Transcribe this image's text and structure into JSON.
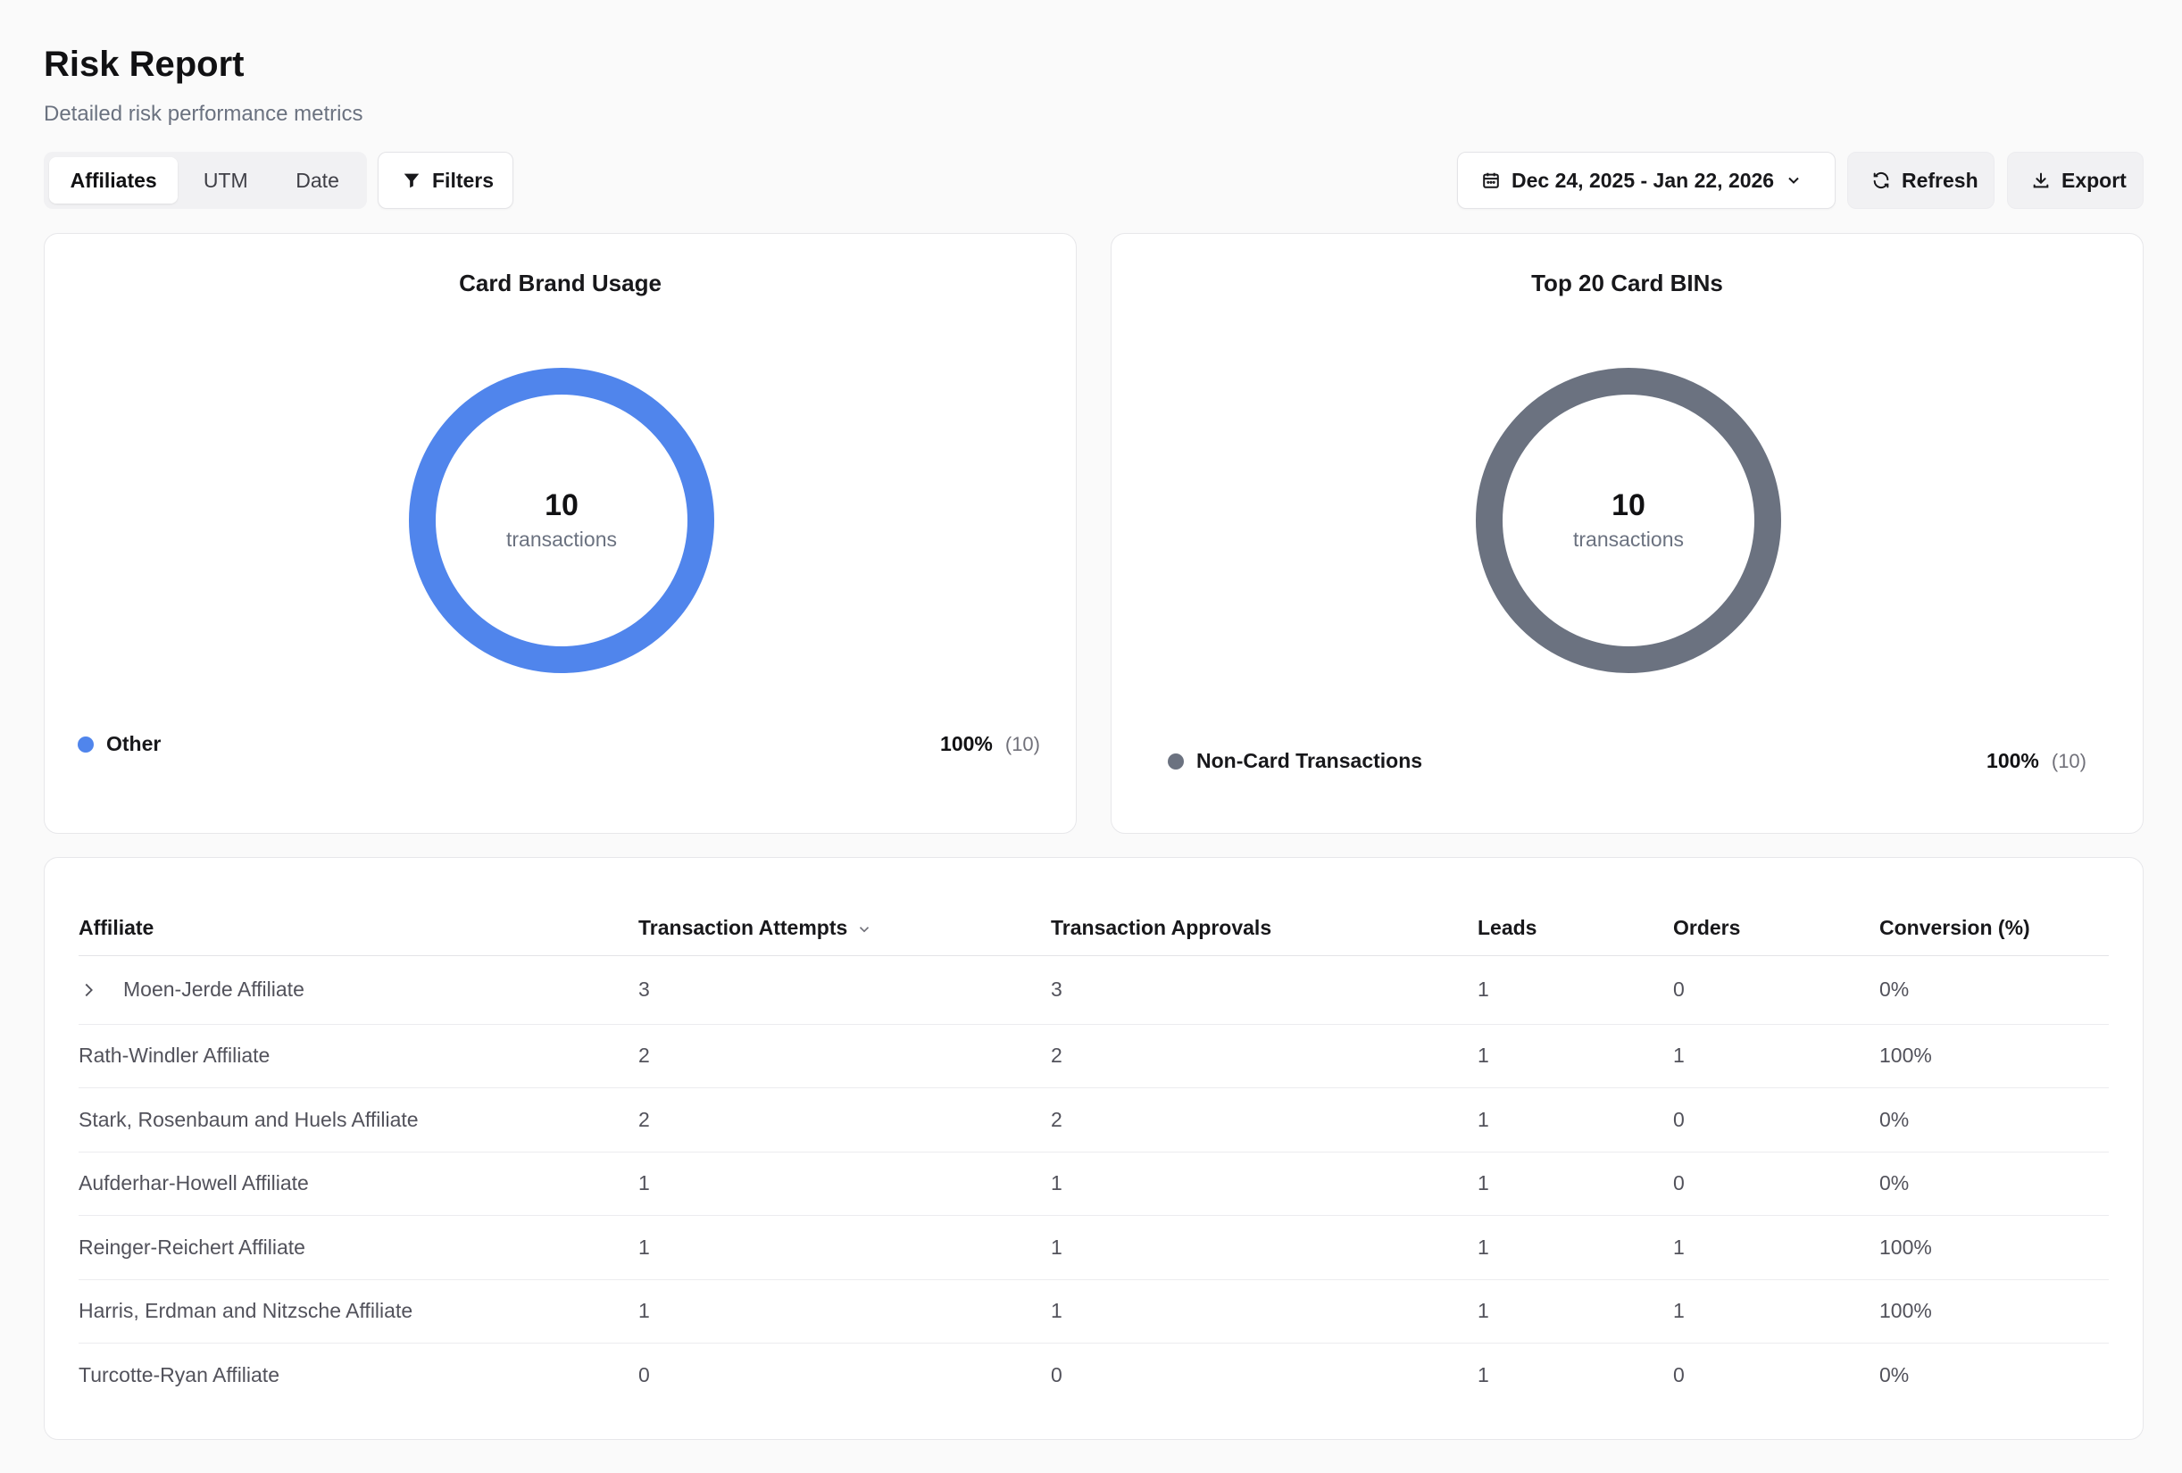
{
  "header": {
    "title": "Risk Report",
    "subtitle": "Detailed risk performance metrics"
  },
  "toolbar": {
    "tabs": [
      {
        "label": "Affiliates",
        "active": true
      },
      {
        "label": "UTM",
        "active": false
      },
      {
        "label": "Date",
        "active": false
      }
    ],
    "filters_label": "Filters",
    "date_range": "Dec 24, 2025 - Jan 22, 2026",
    "refresh_label": "Refresh",
    "export_label": "Export"
  },
  "colors": {
    "card_brand_primary": "#5085ec",
    "non_card": "#6b7280"
  },
  "charts": {
    "card_brand": {
      "title": "Card Brand Usage",
      "center_count": "10",
      "center_label": "transactions",
      "legend": [
        {
          "name": "Other",
          "percent": "100%",
          "count": "(10)"
        }
      ]
    },
    "top_bins": {
      "title": "Top 20 Card BINs",
      "center_count": "10",
      "center_label": "transactions",
      "legend": [
        {
          "name": "Non-Card Transactions",
          "percent": "100%",
          "count": "(10)"
        }
      ]
    }
  },
  "table": {
    "columns": [
      "Affiliate",
      "Transaction Attempts",
      "Transaction Approvals",
      "Leads",
      "Orders",
      "Conversion (%)"
    ],
    "rows": [
      {
        "affiliate": "Moen-Jerde Affiliate",
        "attempts": "3",
        "approvals": "3",
        "leads": "1",
        "orders": "0",
        "conversion": "0%"
      },
      {
        "affiliate": "Rath-Windler Affiliate",
        "attempts": "2",
        "approvals": "2",
        "leads": "1",
        "orders": "1",
        "conversion": "100%"
      },
      {
        "affiliate": "Stark, Rosenbaum and Huels Affiliate",
        "attempts": "2",
        "approvals": "2",
        "leads": "1",
        "orders": "0",
        "conversion": "0%"
      },
      {
        "affiliate": "Aufderhar-Howell Affiliate",
        "attempts": "1",
        "approvals": "1",
        "leads": "1",
        "orders": "0",
        "conversion": "0%"
      },
      {
        "affiliate": "Reinger-Reichert Affiliate",
        "attempts": "1",
        "approvals": "1",
        "leads": "1",
        "orders": "1",
        "conversion": "100%"
      },
      {
        "affiliate": "Harris, Erdman and Nitzsche Affiliate",
        "attempts": "1",
        "approvals": "1",
        "leads": "1",
        "orders": "1",
        "conversion": "100%"
      },
      {
        "affiliate": "Turcotte-Ryan Affiliate",
        "attempts": "0",
        "approvals": "0",
        "leads": "1",
        "orders": "0",
        "conversion": "0%"
      }
    ]
  }
}
